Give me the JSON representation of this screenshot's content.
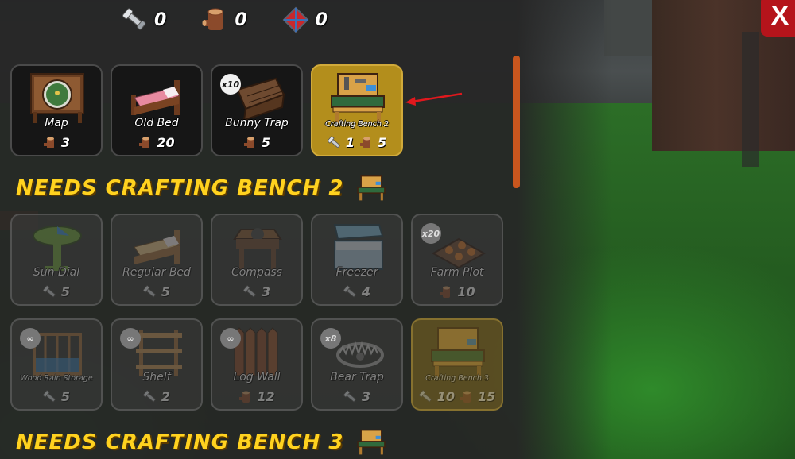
{
  "resources": [
    {
      "icon": "scrap-metal-icon",
      "count": "0"
    },
    {
      "icon": "log-icon",
      "count": "0"
    },
    {
      "icon": "red-gem-icon",
      "count": "0"
    }
  ],
  "close_label": "X",
  "colors": {
    "accent_yellow": "#ffd21f",
    "highlight_gold": "#b38e1c",
    "close_red": "#b5141b"
  },
  "row1": [
    {
      "name": "Map",
      "icon": "map-icon",
      "costs": [
        {
          "type": "log",
          "amount": "3"
        }
      ]
    },
    {
      "name": "Old Bed",
      "icon": "old-bed-icon",
      "costs": [
        {
          "type": "log",
          "amount": "20"
        }
      ]
    },
    {
      "name": "Bunny Trap",
      "icon": "bunny-trap-icon",
      "badge": "x10",
      "costs": [
        {
          "type": "log",
          "amount": "5"
        }
      ]
    },
    {
      "name": "Crafting Bench 2",
      "icon": "crafting-bench-icon",
      "costs": [
        {
          "type": "scrap",
          "amount": "1"
        },
        {
          "type": "log",
          "amount": "5"
        }
      ]
    }
  ],
  "section1": "NEEDS CRAFTING BENCH 2",
  "row2": [
    {
      "name": "Sun Dial",
      "icon": "sun-dial-icon",
      "costs": [
        {
          "type": "scrap",
          "amount": "5"
        }
      ]
    },
    {
      "name": "Regular Bed",
      "icon": "regular-bed-icon",
      "costs": [
        {
          "type": "scrap",
          "amount": "5"
        }
      ]
    },
    {
      "name": "Compass",
      "icon": "compass-icon",
      "costs": [
        {
          "type": "scrap",
          "amount": "3"
        }
      ]
    },
    {
      "name": "Freezer",
      "icon": "freezer-icon",
      "costs": [
        {
          "type": "scrap",
          "amount": "4"
        }
      ]
    },
    {
      "name": "Farm Plot",
      "icon": "farm-plot-icon",
      "badge": "x20",
      "costs": [
        {
          "type": "log",
          "amount": "10"
        }
      ]
    }
  ],
  "row3": [
    {
      "name": "Wood Rain Storage",
      "icon": "wood-rain-storage-icon",
      "badge": "∞",
      "costs": [
        {
          "type": "scrap",
          "amount": "5"
        }
      ]
    },
    {
      "name": "Shelf",
      "icon": "shelf-icon",
      "badge": "∞",
      "costs": [
        {
          "type": "scrap",
          "amount": "2"
        }
      ]
    },
    {
      "name": "Log Wall",
      "icon": "log-wall-icon",
      "badge": "∞",
      "costs": [
        {
          "type": "log",
          "amount": "12"
        }
      ]
    },
    {
      "name": "Bear Trap",
      "icon": "bear-trap-icon",
      "badge": "x8",
      "costs": [
        {
          "type": "scrap",
          "amount": "3"
        }
      ]
    },
    {
      "name": "Crafting Bench 3",
      "icon": "crafting-bench-icon",
      "costs": [
        {
          "type": "scrap",
          "amount": "10"
        },
        {
          "type": "log",
          "amount": "15"
        }
      ]
    }
  ],
  "section2": "NEEDS CRAFTING BENCH 3"
}
